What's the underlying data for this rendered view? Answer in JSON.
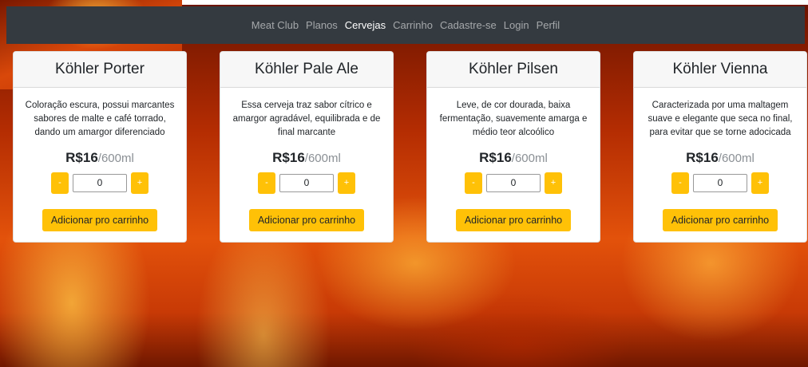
{
  "navbar": {
    "brand": "Meat Club",
    "items": [
      {
        "label": "Planos",
        "active": false
      },
      {
        "label": "Cervejas",
        "active": true
      },
      {
        "label": "Carrinho",
        "active": false
      },
      {
        "label": "Cadastre-se",
        "active": false
      },
      {
        "label": "Login",
        "active": false
      },
      {
        "label": "Perfil",
        "active": false
      }
    ]
  },
  "products": [
    {
      "name": "Köhler Porter",
      "description": "Coloração escura, possui marcantes sabores de malte e café torrado, dando um amargor diferenciado",
      "price": "R$16",
      "unit": "/600ml",
      "minus_label": "-",
      "quantity": "0",
      "plus_label": "+",
      "add_label": "Adicionar pro carrinho"
    },
    {
      "name": "Köhler Pale Ale",
      "description": "Essa cerveja traz sabor cítrico e amargor agradável, equilibrada e de final marcante",
      "price": "R$16",
      "unit": "/600ml",
      "minus_label": "-",
      "quantity": "0",
      "plus_label": "+",
      "add_label": "Adicionar pro carrinho"
    },
    {
      "name": "Köhler Pilsen",
      "description": "Leve, de cor dourada, baixa fermentação, suavemente amarga e médio teor alcoólico",
      "price": "R$16",
      "unit": "/600ml",
      "minus_label": "-",
      "quantity": "0",
      "plus_label": "+",
      "add_label": "Adicionar pro carrinho"
    },
    {
      "name": "Köhler Vienna",
      "description": "Caracterizada por uma maltagem suave e elegante que seca no final, para evitar que se torne adocicada",
      "price": "R$16",
      "unit": "/600ml",
      "minus_label": "-",
      "quantity": "0",
      "plus_label": "+",
      "add_label": "Adicionar pro carrinho"
    }
  ],
  "colors": {
    "navbar_bg": "#343a40",
    "accent": "#ffc107",
    "card_bg": "#ffffff"
  }
}
